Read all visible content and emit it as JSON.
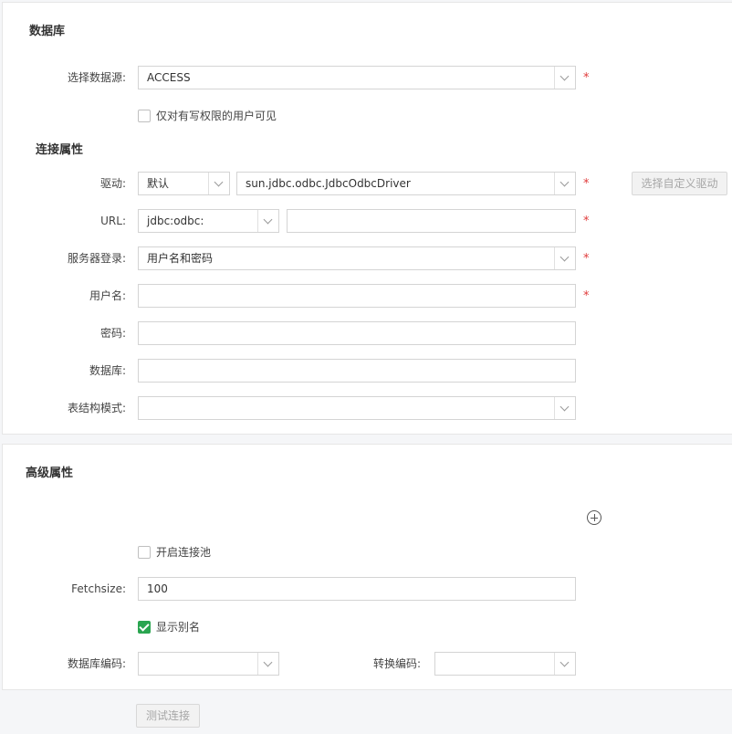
{
  "database_section": {
    "title": "数据库",
    "datasource_label": "选择数据源:",
    "datasource_value": "ACCESS",
    "write_only_label": "仅对有写权限的用户可见",
    "write_only_checked": false
  },
  "connection": {
    "title": "连接属性",
    "driver_label": "驱动:",
    "driver_mode": "默认",
    "driver_class": "sun.jdbc.odbc.JdbcOdbcDriver",
    "custom_driver_button": "选择自定义驱动",
    "url_label": "URL:",
    "url_prefix": "jdbc:odbc:",
    "url_value": "",
    "login_label": "服务器登录:",
    "login_value": "用户名和密码",
    "username_label": "用户名:",
    "username_value": "",
    "password_label": "密码:",
    "password_value": "",
    "database_label": "数据库:",
    "database_value": "",
    "schema_label": "表结构模式:",
    "schema_value": "",
    "required_mark": "*"
  },
  "advanced": {
    "title": "高级属性",
    "add_icon": "plus-circle-icon",
    "pool_label": "开启连接池",
    "pool_checked": false,
    "fetchsize_label": "Fetchsize:",
    "fetchsize_value": "100",
    "alias_label": "显示别名",
    "alias_checked": true,
    "db_encoding_label": "数据库编码:",
    "db_encoding_value": "",
    "convert_encoding_label": "转换编码:",
    "convert_encoding_value": ""
  },
  "footer": {
    "test_button": "测试连接"
  },
  "colors": {
    "required": "#e03a3a",
    "checked": "#2aa550",
    "border": "#d4d4d4",
    "background": "#f5f6f8"
  }
}
